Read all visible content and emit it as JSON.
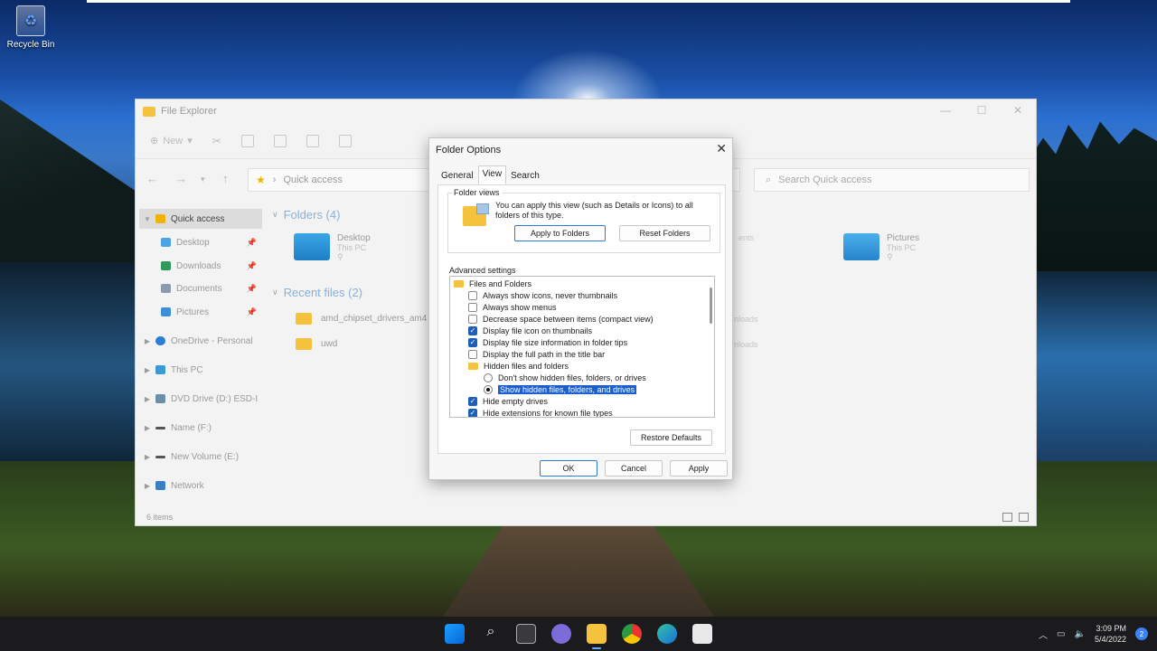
{
  "desktop": {
    "recycle_bin_label": "Recycle Bin"
  },
  "explorer": {
    "title": "File Explorer",
    "toolbar": {
      "new_label": "New"
    },
    "address": "Quick access",
    "search_placeholder": "Search Quick access",
    "sidebar": [
      {
        "label": "Quick access",
        "selected": true
      },
      {
        "label": "Desktop",
        "pinned": true
      },
      {
        "label": "Downloads",
        "pinned": true
      },
      {
        "label": "Documents",
        "pinned": true
      },
      {
        "label": "Pictures",
        "pinned": true
      },
      {
        "label": "OneDrive - Personal"
      },
      {
        "label": "This PC"
      },
      {
        "label": "DVD Drive (D:) ESD-I"
      },
      {
        "label": "Name (F:)"
      },
      {
        "label": "New Volume (E:)"
      },
      {
        "label": "Network"
      }
    ],
    "folders_header": "Folders (4)",
    "folders": [
      {
        "name": "Desktop",
        "location": "This PC"
      },
      {
        "name": "Pictures",
        "location": "This PC"
      }
    ],
    "recent_header": "Recent files (2)",
    "recent": [
      {
        "name": "amd_chipset_drivers_am4"
      },
      {
        "name": "uwd"
      }
    ],
    "ghost_texts": [
      "ents",
      "nloads",
      "nloads"
    ],
    "status": "6 items"
  },
  "dialog": {
    "title": "Folder Options",
    "tabs": [
      "General",
      "View",
      "Search"
    ],
    "active_tab": "View",
    "folder_views_label": "Folder views",
    "folder_views_text": "You can apply this view (such as Details or Icons) to all folders of this type.",
    "apply_to_folders": "Apply to Folders",
    "reset_folders": "Reset Folders",
    "advanced_label": "Advanced settings",
    "advanced": [
      {
        "type": "folder",
        "label": "Files and Folders"
      },
      {
        "type": "check",
        "label": "Always show icons, never thumbnails",
        "checked": false
      },
      {
        "type": "check",
        "label": "Always show menus",
        "checked": false
      },
      {
        "type": "check",
        "label": "Decrease space between items (compact view)",
        "checked": false
      },
      {
        "type": "check",
        "label": "Display file icon on thumbnails",
        "checked": true
      },
      {
        "type": "check",
        "label": "Display file size information in folder tips",
        "checked": true
      },
      {
        "type": "check",
        "label": "Display the full path in the title bar",
        "checked": false
      },
      {
        "type": "folder",
        "label": "Hidden files and folders"
      },
      {
        "type": "radio",
        "label": "Don't show hidden files, folders, or drives",
        "checked": false
      },
      {
        "type": "radio",
        "label": "Show hidden files, folders, and drives",
        "checked": true,
        "highlighted": true
      },
      {
        "type": "check",
        "label": "Hide empty drives",
        "checked": true
      },
      {
        "type": "check",
        "label": "Hide extensions for known file types",
        "checked": true
      }
    ],
    "restore_defaults": "Restore Defaults",
    "ok": "OK",
    "cancel": "Cancel",
    "apply": "Apply"
  },
  "taskbar": {
    "apps": [
      "start-icon",
      "search-icon",
      "task-view-icon",
      "chat-icon",
      "file-explorer-icon",
      "chrome-icon",
      "edge-icon",
      "store-icon"
    ],
    "time": "3:09 PM",
    "date": "5/4/2022",
    "notification_count": "2"
  },
  "colors": {
    "accent": "#1a5fd0",
    "taskbar": "#1b1b1d",
    "folder": "#f4c23c"
  }
}
